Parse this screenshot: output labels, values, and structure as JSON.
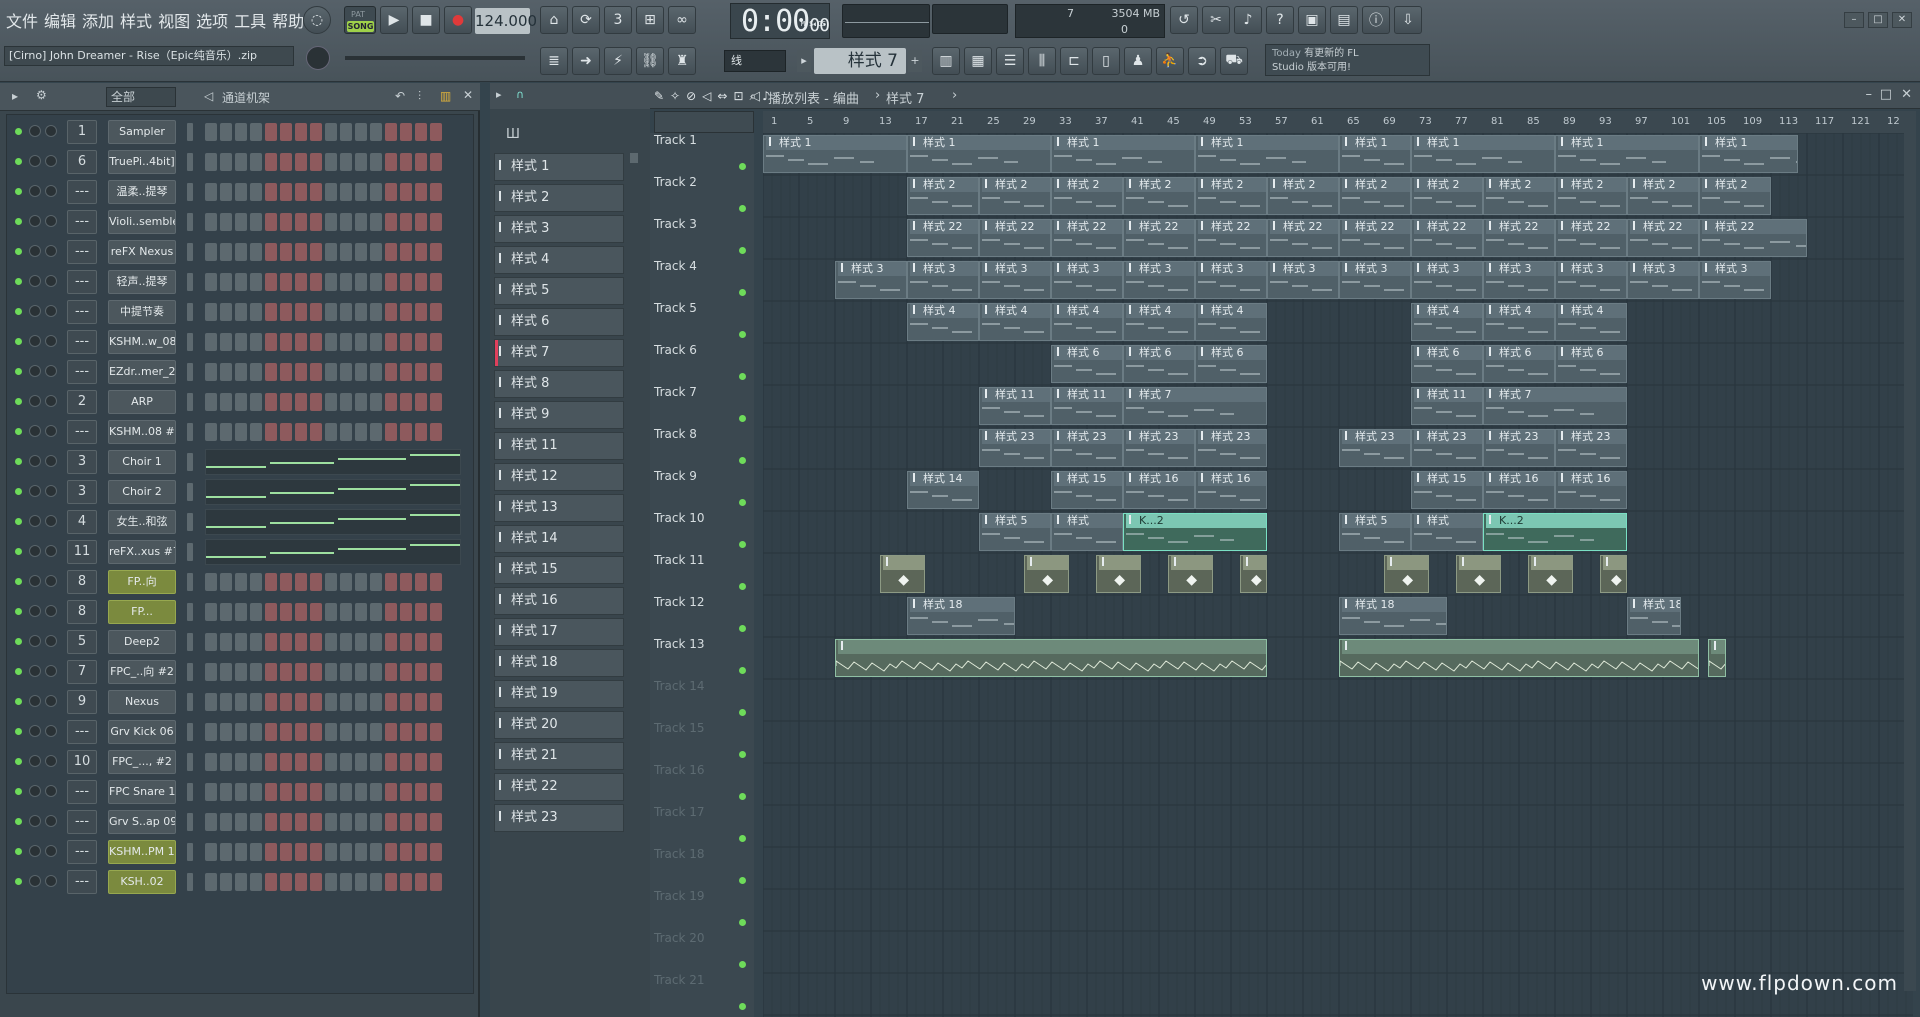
{
  "menu": [
    "文件",
    "编辑",
    "添加",
    "样式",
    "视图",
    "选项",
    "工具",
    "帮助"
  ],
  "transport": {
    "song_label": "SONG",
    "pat_label": "PAT",
    "tempo": "124.000",
    "time": "0:00",
    "time_sub": "00",
    "time_unit": "M:S:CS",
    "play_icon": "play-icon",
    "stop_icon": "stop-icon",
    "record_icon": "record-icon"
  },
  "memory": {
    "cpu": "7",
    "mem": "3504 MB",
    "polyphony": "0"
  },
  "project_title": "[Cirno] John Dreamer - Rise（Epic纯音乐）.zip",
  "news": {
    "today": "Today",
    "line1": "有更新的 FL",
    "line2": "Studio 版本可用!"
  },
  "snap": "线",
  "current_pattern": "样式 7",
  "rack": {
    "filter": "全部",
    "title": "通道机架",
    "channels": [
      {
        "num": "1",
        "name": "Sampler",
        "type": "steps"
      },
      {
        "num": "6",
        "name": "TruePi..4bit]",
        "type": "steps"
      },
      {
        "num": "---",
        "name": "温柔..提琴",
        "type": "steps"
      },
      {
        "num": "---",
        "name": "Violi..semble",
        "type": "steps"
      },
      {
        "num": "---",
        "name": "reFX Nexus",
        "type": "steps"
      },
      {
        "num": "---",
        "name": "轻声..提琴",
        "type": "steps"
      },
      {
        "num": "---",
        "name": "中提节奏",
        "type": "steps"
      },
      {
        "num": "---",
        "name": "KSHM..w_08",
        "type": "steps"
      },
      {
        "num": "---",
        "name": "EZdr..mer_2",
        "type": "steps"
      },
      {
        "num": "2",
        "name": "ARP",
        "type": "steps"
      },
      {
        "num": "---",
        "name": "KSHM..08 #2",
        "type": "steps"
      },
      {
        "num": "3",
        "name": "Choir 1",
        "type": "roll"
      },
      {
        "num": "3",
        "name": "Choir 2",
        "type": "roll"
      },
      {
        "num": "4",
        "name": "女生..和弦",
        "type": "roll"
      },
      {
        "num": "11",
        "name": "reFX..xus #7",
        "type": "roll"
      },
      {
        "num": "8",
        "name": "FP..向",
        "type": "steps",
        "hl": true
      },
      {
        "num": "8",
        "name": "FP...",
        "type": "steps",
        "hl": true
      },
      {
        "num": "5",
        "name": "Deep2",
        "type": "steps"
      },
      {
        "num": "7",
        "name": "FPC_..向 #2",
        "type": "steps"
      },
      {
        "num": "9",
        "name": "Nexus",
        "type": "steps"
      },
      {
        "num": "---",
        "name": "Grv Kick 06",
        "type": "steps"
      },
      {
        "num": "10",
        "name": "FPC_..., #2",
        "type": "steps"
      },
      {
        "num": "---",
        "name": "FPC Snare 1",
        "type": "steps"
      },
      {
        "num": "---",
        "name": "Grv S..ap 09",
        "type": "steps"
      },
      {
        "num": "---",
        "name": "KSHM..PM 13",
        "type": "steps",
        "hl": true
      },
      {
        "num": "---",
        "name": "KSH..02",
        "type": "steps",
        "hl": true
      }
    ]
  },
  "patterns": [
    "样式 1",
    "样式 2",
    "样式 3",
    "样式 4",
    "样式 5",
    "样式 6",
    "样式 7",
    "样式 8",
    "样式 9",
    "样式 11",
    "样式 12",
    "样式 13",
    "样式 14",
    "样式 15",
    "样式 16",
    "样式 17",
    "样式 18",
    "样式 19",
    "样式 20",
    "样式 21",
    "样式 22",
    "样式 23"
  ],
  "playlist": {
    "title": "播放列表 - 编曲",
    "breadcrumb": "样式 7",
    "ruler": [
      "1",
      "5",
      "9",
      "13",
      "17",
      "21",
      "25",
      "29",
      "33",
      "37",
      "41",
      "45",
      "49",
      "53",
      "57",
      "61",
      "65",
      "69",
      "73",
      "77",
      "81",
      "85",
      "89",
      "93",
      "97",
      "101",
      "105",
      "109",
      "113",
      "117",
      "121",
      "12"
    ],
    "tracks": [
      "Track 1",
      "Track 2",
      "Track 3",
      "Track 4",
      "Track 5",
      "Track 6",
      "Track 7",
      "Track 8",
      "Track 9",
      "Track 10",
      "Track 11",
      "Track 12",
      "Track 13",
      "Track 14",
      "Track 15",
      "Track 16",
      "Track 17",
      "Track 18",
      "Track 19",
      "Track 20",
      "Track 21"
    ],
    "clips": [
      {
        "t": 0,
        "s": 1,
        "e": 17,
        "l": "样式 1"
      },
      {
        "t": 0,
        "s": 17,
        "e": 33,
        "l": "样式 1"
      },
      {
        "t": 0,
        "s": 33,
        "e": 49,
        "l": "样式 1"
      },
      {
        "t": 0,
        "s": 49,
        "e": 65,
        "l": "样式 1"
      },
      {
        "t": 0,
        "s": 65,
        "e": 73,
        "l": "样式 1"
      },
      {
        "t": 0,
        "s": 73,
        "e": 89,
        "l": "样式 1"
      },
      {
        "t": 0,
        "s": 89,
        "e": 105,
        "l": "样式 1"
      },
      {
        "t": 0,
        "s": 105,
        "e": 116,
        "l": "样式 1"
      },
      {
        "t": 1,
        "s": 17,
        "e": 25,
        "l": "样式 2"
      },
      {
        "t": 1,
        "s": 25,
        "e": 33,
        "l": "样式 2"
      },
      {
        "t": 1,
        "s": 33,
        "e": 41,
        "l": "样式 2"
      },
      {
        "t": 1,
        "s": 41,
        "e": 49,
        "l": "样式 2"
      },
      {
        "t": 1,
        "s": 49,
        "e": 57,
        "l": "样式 2"
      },
      {
        "t": 1,
        "s": 57,
        "e": 65,
        "l": "样式 2"
      },
      {
        "t": 1,
        "s": 65,
        "e": 73,
        "l": "样式 2"
      },
      {
        "t": 1,
        "s": 73,
        "e": 81,
        "l": "样式 2"
      },
      {
        "t": 1,
        "s": 81,
        "e": 89,
        "l": "样式 2"
      },
      {
        "t": 1,
        "s": 89,
        "e": 97,
        "l": "样式 2"
      },
      {
        "t": 1,
        "s": 97,
        "e": 105,
        "l": "样式 2"
      },
      {
        "t": 1,
        "s": 105,
        "e": 113,
        "l": "样式 2"
      },
      {
        "t": 2,
        "s": 17,
        "e": 25,
        "l": "样式 22"
      },
      {
        "t": 2,
        "s": 25,
        "e": 33,
        "l": "样式 22"
      },
      {
        "t": 2,
        "s": 33,
        "e": 41,
        "l": "样式 22"
      },
      {
        "t": 2,
        "s": 41,
        "e": 49,
        "l": "样式 22"
      },
      {
        "t": 2,
        "s": 49,
        "e": 57,
        "l": "样式 22"
      },
      {
        "t": 2,
        "s": 57,
        "e": 65,
        "l": "样式 22"
      },
      {
        "t": 2,
        "s": 65,
        "e": 73,
        "l": "样式 22"
      },
      {
        "t": 2,
        "s": 73,
        "e": 81,
        "l": "样式 22"
      },
      {
        "t": 2,
        "s": 81,
        "e": 89,
        "l": "样式 22"
      },
      {
        "t": 2,
        "s": 89,
        "e": 97,
        "l": "样式 22"
      },
      {
        "t": 2,
        "s": 97,
        "e": 105,
        "l": "样式 22"
      },
      {
        "t": 2,
        "s": 105,
        "e": 117,
        "l": "样式 22"
      },
      {
        "t": 3,
        "s": 9,
        "e": 17,
        "l": "样式 3"
      },
      {
        "t": 3,
        "s": 17,
        "e": 25,
        "l": "样式 3"
      },
      {
        "t": 3,
        "s": 25,
        "e": 33,
        "l": "样式 3"
      },
      {
        "t": 3,
        "s": 33,
        "e": 41,
        "l": "样式 3"
      },
      {
        "t": 3,
        "s": 41,
        "e": 49,
        "l": "样式 3"
      },
      {
        "t": 3,
        "s": 49,
        "e": 57,
        "l": "样式 3"
      },
      {
        "t": 3,
        "s": 57,
        "e": 65,
        "l": "样式 3"
      },
      {
        "t": 3,
        "s": 65,
        "e": 73,
        "l": "样式 3"
      },
      {
        "t": 3,
        "s": 73,
        "e": 81,
        "l": "样式 3"
      },
      {
        "t": 3,
        "s": 81,
        "e": 89,
        "l": "样式 3"
      },
      {
        "t": 3,
        "s": 89,
        "e": 97,
        "l": "样式 3"
      },
      {
        "t": 3,
        "s": 97,
        "e": 105,
        "l": "样式 3"
      },
      {
        "t": 3,
        "s": 105,
        "e": 113,
        "l": "样式 3"
      },
      {
        "t": 4,
        "s": 17,
        "e": 25,
        "l": "样式 4"
      },
      {
        "t": 4,
        "s": 25,
        "e": 33,
        "l": "样式 4"
      },
      {
        "t": 4,
        "s": 33,
        "e": 41,
        "l": "样式 4"
      },
      {
        "t": 4,
        "s": 41,
        "e": 49,
        "l": "样式 4"
      },
      {
        "t": 4,
        "s": 49,
        "e": 57,
        "l": "样式 4"
      },
      {
        "t": 4,
        "s": 73,
        "e": 81,
        "l": "样式 4"
      },
      {
        "t": 4,
        "s": 81,
        "e": 89,
        "l": "样式 4"
      },
      {
        "t": 4,
        "s": 89,
        "e": 97,
        "l": "样式 4"
      },
      {
        "t": 5,
        "s": 33,
        "e": 41,
        "l": "样式 6"
      },
      {
        "t": 5,
        "s": 41,
        "e": 49,
        "l": "样式 6"
      },
      {
        "t": 5,
        "s": 49,
        "e": 57,
        "l": "样式 6"
      },
      {
        "t": 5,
        "s": 73,
        "e": 81,
        "l": "样式 6"
      },
      {
        "t": 5,
        "s": 81,
        "e": 89,
        "l": "样式 6"
      },
      {
        "t": 5,
        "s": 89,
        "e": 97,
        "l": "样式 6"
      },
      {
        "t": 6,
        "s": 25,
        "e": 33,
        "l": "样式 11"
      },
      {
        "t": 6,
        "s": 33,
        "e": 41,
        "l": "样式 11"
      },
      {
        "t": 6,
        "s": 41,
        "e": 57,
        "l": "样式 7"
      },
      {
        "t": 6,
        "s": 73,
        "e": 81,
        "l": "样式 11"
      },
      {
        "t": 6,
        "s": 81,
        "e": 97,
        "l": "样式 7"
      },
      {
        "t": 7,
        "s": 25,
        "e": 33,
        "l": "样式 23"
      },
      {
        "t": 7,
        "s": 33,
        "e": 41,
        "l": "样式 23"
      },
      {
        "t": 7,
        "s": 41,
        "e": 49,
        "l": "样式 23"
      },
      {
        "t": 7,
        "s": 49,
        "e": 57,
        "l": "样式 23"
      },
      {
        "t": 7,
        "s": 65,
        "e": 73,
        "l": "样式 23"
      },
      {
        "t": 7,
        "s": 73,
        "e": 81,
        "l": "样式 23"
      },
      {
        "t": 7,
        "s": 81,
        "e": 89,
        "l": "样式 23"
      },
      {
        "t": 7,
        "s": 89,
        "e": 97,
        "l": "样式 23"
      },
      {
        "t": 8,
        "s": 17,
        "e": 25,
        "l": "样式 14"
      },
      {
        "t": 8,
        "s": 33,
        "e": 41,
        "l": "样式 15"
      },
      {
        "t": 8,
        "s": 41,
        "e": 49,
        "l": "样式 16"
      },
      {
        "t": 8,
        "s": 49,
        "e": 57,
        "l": "样式 16"
      },
      {
        "t": 8,
        "s": 73,
        "e": 81,
        "l": "样式 15"
      },
      {
        "t": 8,
        "s": 81,
        "e": 89,
        "l": "样式 16"
      },
      {
        "t": 8,
        "s": 89,
        "e": 97,
        "l": "样式 16"
      },
      {
        "t": 9,
        "s": 25,
        "e": 33,
        "l": "样式 5"
      },
      {
        "t": 9,
        "s": 33,
        "e": 41,
        "l": "样式"
      },
      {
        "t": 9,
        "s": 41,
        "e": 57,
        "l": "K...2",
        "k": "hi"
      },
      {
        "t": 9,
        "s": 65,
        "e": 73,
        "l": "样式 5"
      },
      {
        "t": 9,
        "s": 73,
        "e": 81,
        "l": "样式"
      },
      {
        "t": 9,
        "s": 81,
        "e": 97,
        "l": "K...2",
        "k": "hi"
      },
      {
        "t": 10,
        "s": 14,
        "e": 19,
        "l": "",
        "k": "beat"
      },
      {
        "t": 10,
        "s": 30,
        "e": 35,
        "l": "",
        "k": "beat"
      },
      {
        "t": 10,
        "s": 38,
        "e": 43,
        "l": "",
        "k": "beat"
      },
      {
        "t": 10,
        "s": 46,
        "e": 51,
        "l": "",
        "k": "beat"
      },
      {
        "t": 10,
        "s": 54,
        "e": 57,
        "l": "",
        "k": "beat"
      },
      {
        "t": 10,
        "s": 70,
        "e": 75,
        "l": "",
        "k": "beat"
      },
      {
        "t": 10,
        "s": 78,
        "e": 83,
        "l": "",
        "k": "beat"
      },
      {
        "t": 10,
        "s": 86,
        "e": 91,
        "l": "",
        "k": "beat"
      },
      {
        "t": 10,
        "s": 94,
        "e": 97,
        "l": "",
        "k": "beat"
      },
      {
        "t": 11,
        "s": 17,
        "e": 29,
        "l": "样式 18"
      },
      {
        "t": 11,
        "s": 65,
        "e": 77,
        "l": "样式 18"
      },
      {
        "t": 11,
        "s": 97,
        "e": 103,
        "l": "样式 18"
      },
      {
        "t": 12,
        "s": 9,
        "e": 57,
        "l": "",
        "k": "audio"
      },
      {
        "t": 12,
        "s": 65,
        "e": 105,
        "l": "",
        "k": "audio"
      },
      {
        "t": 12,
        "s": 106,
        "e": 108,
        "l": "",
        "k": "audio"
      }
    ]
  },
  "watermark": "www.flpdown.com"
}
